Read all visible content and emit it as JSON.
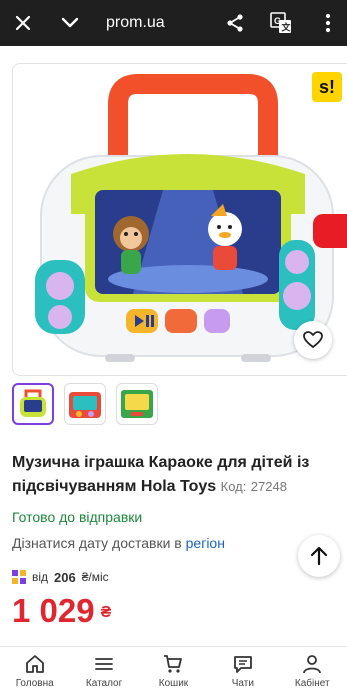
{
  "browser": {
    "url": "prom.ua",
    "icons": [
      "close-icon",
      "chevron-down-icon",
      "share-icon",
      "translate-icon",
      "more-vert-icon"
    ]
  },
  "product": {
    "brand_badge": "s!",
    "title": "Музична іграшка Караоке для дітей із підсвічуванням Hola Toys",
    "code_label": "Код:",
    "code": "27248",
    "availability": "Готово до відправки",
    "delivery_text": "Дізнатися дату доставки в",
    "delivery_link": "регіон",
    "installment_prefix": "від",
    "installment_amount": "206",
    "installment_unit": "₴/міс",
    "price": "1 029",
    "currency": "₴",
    "thumbnails": 3,
    "colors": {
      "price": "#e0262f",
      "available": "#1c8a3a",
      "link": "#1865c8",
      "accent": "#7b3fe4"
    }
  },
  "bottom_nav": [
    {
      "label": "Головна",
      "icon": "home-icon"
    },
    {
      "label": "Каталог",
      "icon": "menu-icon"
    },
    {
      "label": "Кошик",
      "icon": "cart-icon"
    },
    {
      "label": "Чати",
      "icon": "chat-icon"
    },
    {
      "label": "Кабінет",
      "icon": "user-icon"
    }
  ]
}
